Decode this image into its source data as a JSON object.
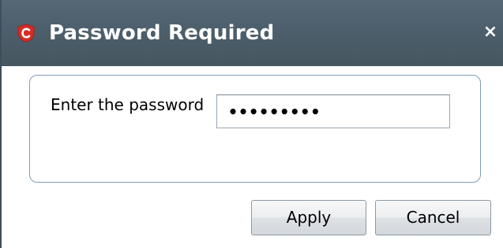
{
  "dialog": {
    "title": "Password Required",
    "logo_icon": "comodo-shield-icon",
    "close_label": "×"
  },
  "form": {
    "password_label": "Enter the password",
    "password_value": "123456789"
  },
  "buttons": {
    "apply_label": "Apply",
    "cancel_label": "Cancel"
  },
  "colors": {
    "titlebar": "#4d5f6c",
    "logo_red": "#d42d26",
    "panel_border": "#7f9db9"
  }
}
